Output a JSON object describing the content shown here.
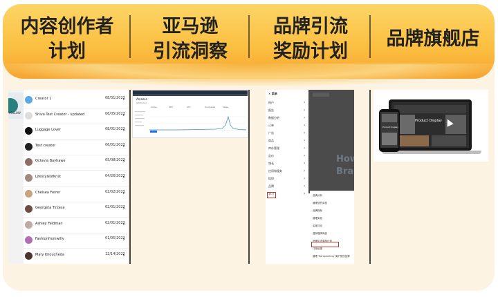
{
  "header": {
    "col1": {
      "line1": "内容创作者",
      "line2": "计划"
    },
    "col2": {
      "line1": "亚马逊",
      "line2": "引流洞察"
    },
    "col3": {
      "line1": "品牌引流",
      "line2": "奖励计划"
    },
    "col4": {
      "line1": "品牌旗舰店",
      "line2": ""
    }
  },
  "creators_panel": {
    "side_label": "FOLLOW",
    "rows": [
      {
        "name": "Creator 1",
        "date": "08/31/2023",
        "avatar_color": "#5aa9e6"
      },
      {
        "name": "Shiva Test Creator - updated",
        "date": "06/05/2023",
        "avatar_color": "#dddddd"
      },
      {
        "name": "Luggage Lover",
        "date": "08/01/2023",
        "avatar_color": "#111111"
      },
      {
        "name": "Test creator",
        "date": "06/01/2023",
        "avatar_color": "#222222"
      },
      {
        "name": "Octavia Bayhawe",
        "date": "05/08/2023",
        "avatar_color": "#8d6e63"
      },
      {
        "name": "LifestyleofKrist",
        "date": "04/26/2023",
        "avatar_color": "#a1887f"
      },
      {
        "name": "Chelsea Ferrer",
        "date": "02/02/2023",
        "avatar_color": "#c9a27e"
      },
      {
        "name": "Georgeta Tirzesa",
        "date": "02/01/2023",
        "avatar_color": "#6d4c41"
      },
      {
        "name": "Ashley Feldman",
        "date": "02/01/2023",
        "avatar_color": "#bcaaa4"
      },
      {
        "name": "Fashionfromwilly",
        "date": "01/05/2023",
        "avatar_color": "#b06fb3"
      },
      {
        "name": "Mary Khoucheda",
        "date": "12/14/2022",
        "avatar_color": "#4e342e"
      }
    ]
  },
  "dashboard_panel": {
    "title": "Amazon",
    "subtitle": "Attribution",
    "labels": [
      "Clicks",
      "DPV",
      "ATC",
      "Purchases",
      "Sales"
    ]
  },
  "menu_panel": {
    "header": "菜单",
    "items": [
      "账户",
      "报告",
      "数据分析",
      "订单",
      "广告",
      "商品",
      "库存管理",
      "定价",
      "增长",
      "应用和服务",
      "B2B",
      "品牌",
      "学习"
    ],
    "submenu": [
      "品牌分析",
      "管理您的实验",
      "品牌指标",
      "管理实验",
      "买家评论",
      "虚拟捆绑商品",
      "品牌引流奖励计划",
      "订阅优惠",
      "管理 Transparency 保护您的品牌"
    ],
    "hero_text": "How Bra"
  },
  "store_panel": {
    "product_text": "Product Display",
    "phone_text": "Product display"
  }
}
